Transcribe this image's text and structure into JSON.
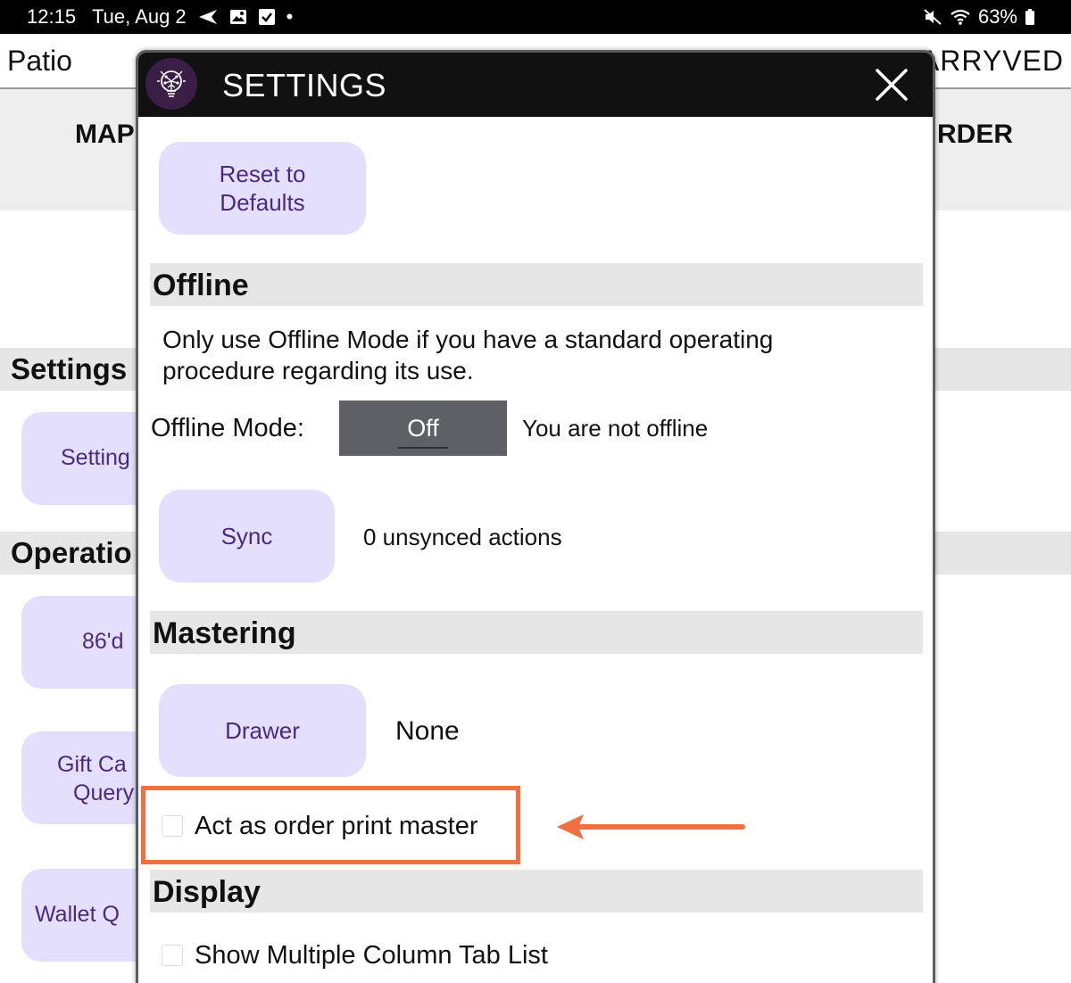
{
  "status_bar": {
    "time": "12:15",
    "date": "Tue, Aug 2",
    "dot": "•",
    "battery": "63%",
    "icons_left": [
      "send-icon",
      "image-icon",
      "checkbox-icon"
    ],
    "icons_right": [
      "mute-icon",
      "wifi-icon",
      "battery-icon"
    ]
  },
  "background": {
    "location": "Patio",
    "brand_fragment": "ARRYVED",
    "tab_left_fragment": "MAP",
    "tab_right_fragment": "RDER",
    "sections": [
      {
        "label": "Settings"
      },
      {
        "label": "Operatio"
      }
    ],
    "buttons": [
      {
        "label": "Setting"
      },
      {
        "label": "86'd"
      },
      {
        "line1": "Gift Ca",
        "line2": "Query"
      },
      {
        "label": "Wallet Q"
      }
    ]
  },
  "modal": {
    "title": "SETTINGS",
    "reset": {
      "line1": "Reset to",
      "line2": "Defaults"
    },
    "offline": {
      "heading": "Offline",
      "description_line1": "Only use Offline Mode if you have a standard operating",
      "description_line2": "procedure regarding its use.",
      "mode_label": "Offline Mode:",
      "toggle_value": "Off",
      "status": "You are not offline",
      "sync_label": "Sync",
      "unsynced": "0 unsynced actions"
    },
    "mastering": {
      "heading": "Mastering",
      "drawer_label": "Drawer",
      "drawer_value": "None",
      "print_master_label": "Act as order print master",
      "print_master_checked": false
    },
    "display": {
      "heading": "Display",
      "multi_column_label": "Show Multiple Column Tab List",
      "multi_column_checked": false
    }
  },
  "colors": {
    "button_bg": "#e4dffd",
    "button_text": "#4a2a80",
    "highlight": "#f07042",
    "toggle_bg": "#5d6166"
  }
}
